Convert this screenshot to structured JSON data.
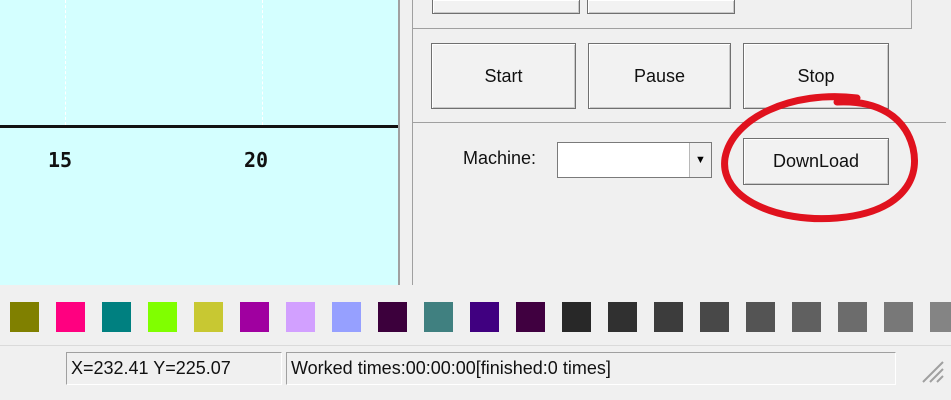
{
  "canvas": {
    "ruler_ticks": [
      "15",
      "20"
    ],
    "background": "#d4ffff"
  },
  "controls": {
    "start_label": "Start",
    "pause_label": "Pause",
    "stop_label": "Stop",
    "machine_label": "Machine:",
    "machine_value": "",
    "download_label": "DownLoad",
    "dropdown_icon": "triangle-down-icon",
    "highlight_color": "#e0121e"
  },
  "palette": {
    "colors": [
      "#808000",
      "#ff0080",
      "#008080",
      "#80ff00",
      "#c8c832",
      "#a000a0",
      "#d2a0ff",
      "#96a0ff",
      "#3c003c",
      "#408080",
      "#400080",
      "#400040",
      "#282828",
      "#303030",
      "#3c3c3c",
      "#484848",
      "#545454",
      "#606060",
      "#6c6c6c",
      "#787878",
      "#848484",
      "#909090"
    ]
  },
  "status": {
    "coords": "X=232.41 Y=225.07",
    "worked": "Worked times:00:00:00[finished:0 times]"
  }
}
